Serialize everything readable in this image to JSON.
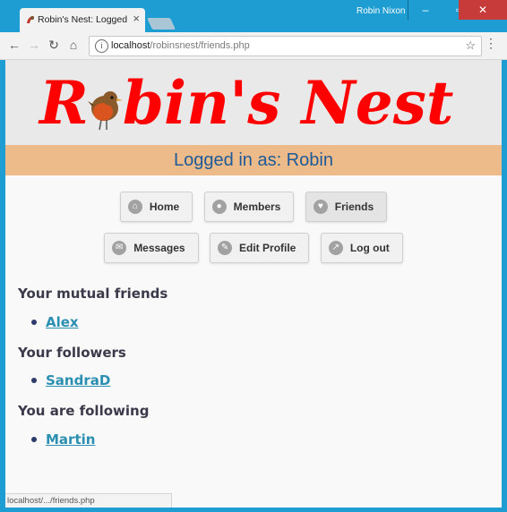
{
  "browser": {
    "tab_title": "Robin's Nest: Logged in",
    "tab_close": "×",
    "user_name": "Robin Nixon",
    "url_host": "localhost",
    "url_path": "/robinsnest/friends.php",
    "status_url": "localhost/.../friends.php",
    "controls": {
      "minimize": "–",
      "maximize": "▫",
      "close": "✕"
    },
    "icons": {
      "back": "←",
      "forward": "→",
      "reload": "↻",
      "home": "⌂",
      "info": "i",
      "star": "☆",
      "menu": "⋮"
    }
  },
  "site": {
    "logo_pre": "R",
    "logo_post": "bin's Nest",
    "logged_in_text": "Logged in as: Robin",
    "accent_color": "#ff0000"
  },
  "nav": {
    "home": "Home",
    "members": "Members",
    "friends": "Friends",
    "messages": "Messages",
    "edit_profile": "Edit Profile",
    "log_out": "Log out"
  },
  "sections": {
    "mutual_title": "Your mutual friends",
    "mutual": [
      "Alex"
    ],
    "followers_title": "Your followers",
    "followers": [
      "SandraD"
    ],
    "following_title": "You are following",
    "following": [
      "Martin"
    ]
  }
}
